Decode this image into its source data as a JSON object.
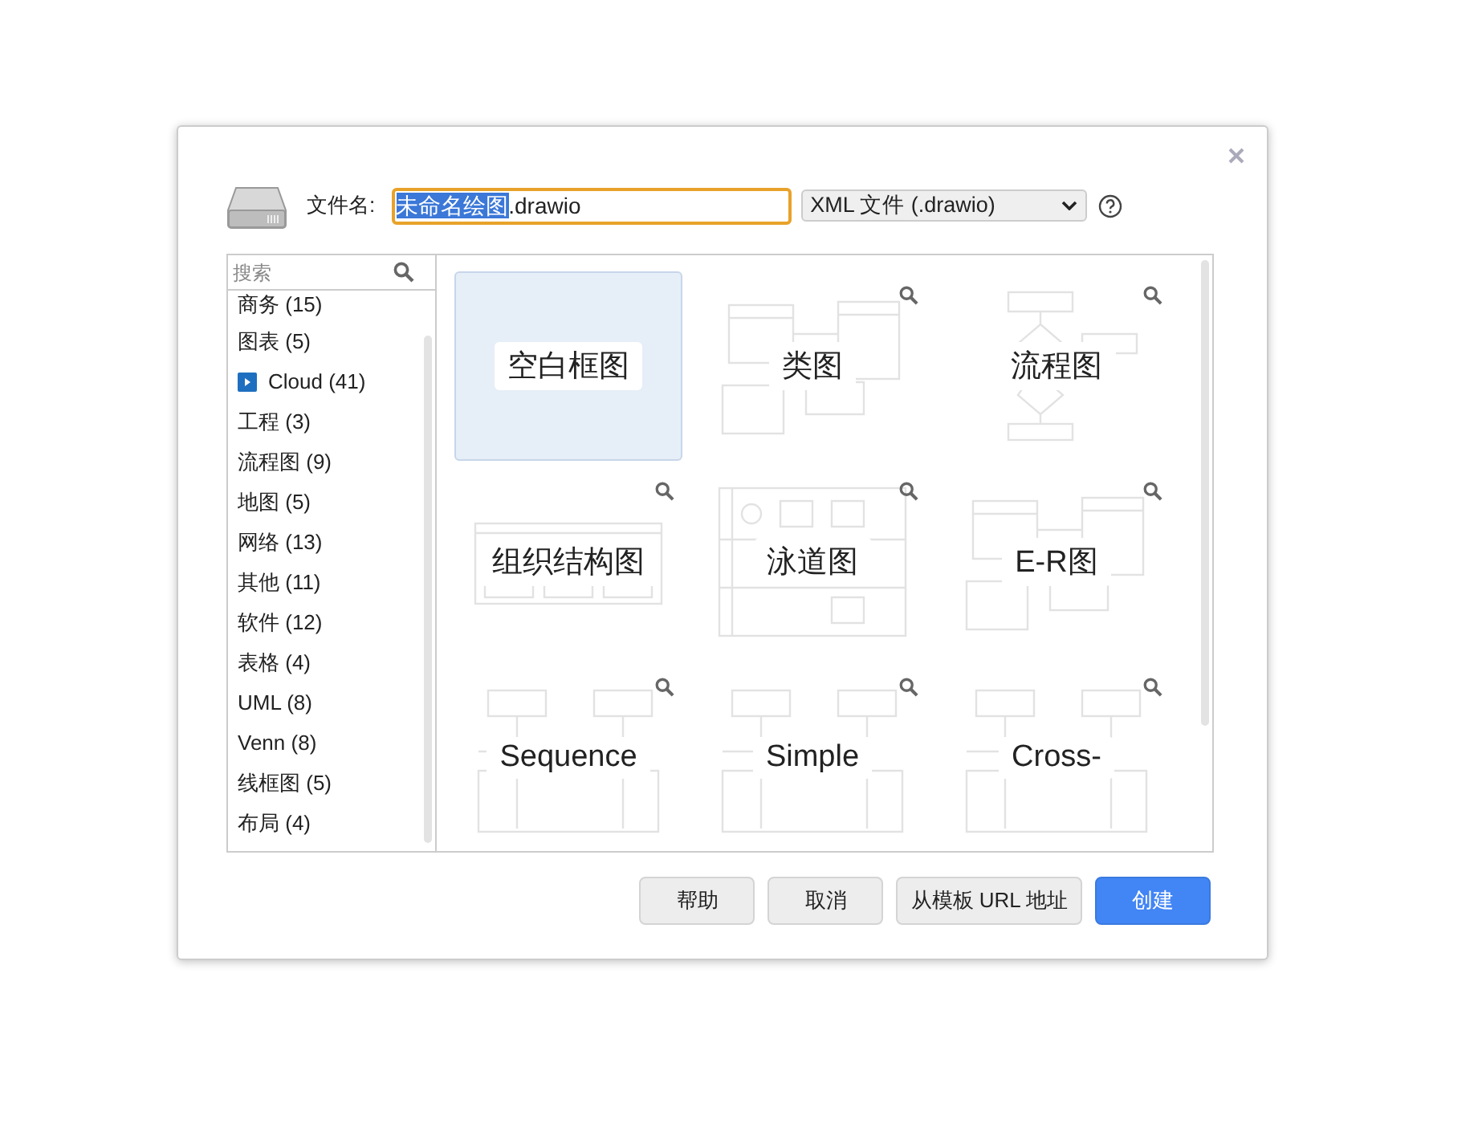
{
  "filename": {
    "label": "文件名:",
    "selected_part": "未命名绘图",
    "rest": ".drawio"
  },
  "format": {
    "value": "XML 文件 (.drawio)"
  },
  "sidebar": {
    "search": {
      "placeholder": "搜索"
    },
    "items": [
      {
        "label": "商务 (15)",
        "kind": "category"
      },
      {
        "label": "图表 (5)",
        "kind": "category"
      },
      {
        "label": "Cloud (41)",
        "kind": "collapsed"
      },
      {
        "label": "工程 (3)",
        "kind": "category"
      },
      {
        "label": "流程图 (9)",
        "kind": "category"
      },
      {
        "label": "地图 (5)",
        "kind": "category"
      },
      {
        "label": "网络 (13)",
        "kind": "category"
      },
      {
        "label": "其他 (11)",
        "kind": "category"
      },
      {
        "label": "软件 (12)",
        "kind": "category"
      },
      {
        "label": "表格 (4)",
        "kind": "category"
      },
      {
        "label": "UML (8)",
        "kind": "category"
      },
      {
        "label": "Venn (8)",
        "kind": "category"
      },
      {
        "label": "线框图 (5)",
        "kind": "category"
      },
      {
        "label": "布局 (4)",
        "kind": "category"
      }
    ]
  },
  "templates": [
    {
      "label": "空白框图",
      "kind": "blank",
      "selected": true
    },
    {
      "label": "类图",
      "kind": "class",
      "selected": false
    },
    {
      "label": "流程图",
      "kind": "flow",
      "selected": false
    },
    {
      "label": "组织结构图",
      "kind": "org",
      "selected": false
    },
    {
      "label": "泳道图",
      "kind": "swimlane",
      "selected": false
    },
    {
      "label": "E-R图",
      "kind": "er",
      "selected": false
    },
    {
      "label": "Sequence",
      "kind": "sequence",
      "selected": false
    },
    {
      "label": "Simple",
      "kind": "board",
      "selected": false
    },
    {
      "label": "Cross-",
      "kind": "cross",
      "selected": false
    }
  ],
  "buttons": [
    {
      "label": "帮助",
      "kind": "default"
    },
    {
      "label": "取消",
      "kind": "default"
    },
    {
      "label": "从模板 URL 地址",
      "kind": "default"
    },
    {
      "label": "创建",
      "kind": "primary"
    }
  ]
}
